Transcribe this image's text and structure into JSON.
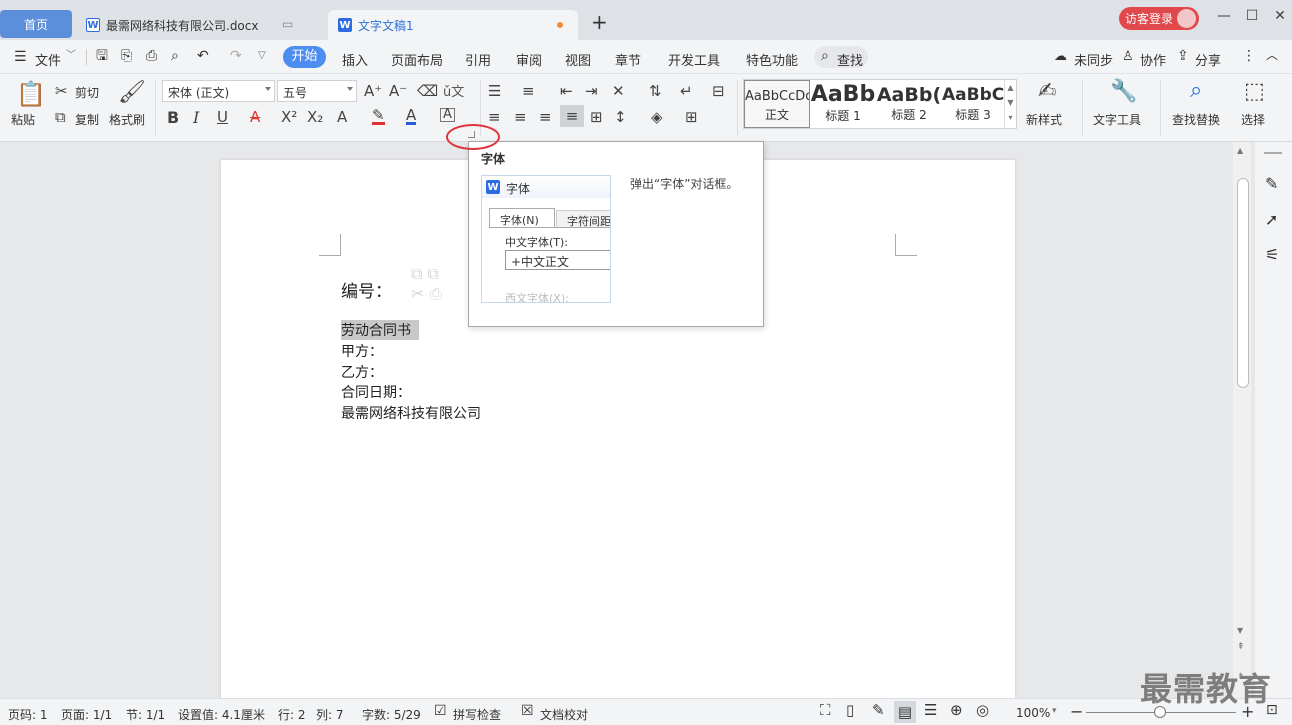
{
  "titlebar": {
    "tabs": [
      {
        "label": "首页"
      },
      {
        "label": "最需网络科技有限公司.docx"
      },
      {
        "label": "文字文稿1"
      }
    ],
    "new_tab": "+",
    "login_label": "访客登录",
    "min": "—",
    "max": "☐",
    "close": "✕"
  },
  "menubar": {
    "file": "文件",
    "items": [
      "开始",
      "插入",
      "页面布局",
      "引用",
      "审阅",
      "视图",
      "章节",
      "开发工具",
      "特色功能"
    ],
    "search": "查找",
    "sync": "未同步",
    "collab": "协作",
    "share": "分享"
  },
  "ribbon": {
    "paste": "粘贴",
    "cut": "剪切",
    "copy": "复制",
    "format_painter": "格式刷",
    "font_name": "宋体 (正文)",
    "font_size": "五号",
    "styles": [
      {
        "preview": "AaBbCcDd",
        "name": "正文"
      },
      {
        "preview": "AaBb",
        "name": "标题 1"
      },
      {
        "preview": "AaBb(",
        "name": "标题 2"
      },
      {
        "preview": "AaBbC",
        "name": "标题 3"
      }
    ],
    "new_style": "新样式",
    "text_tools": "文字工具",
    "find_replace": "查找替换",
    "select": "选择"
  },
  "document": {
    "lines": [
      "编号：",
      "劳动合同书",
      "甲方：",
      "乙方：",
      "合同日期：",
      "最需网络科技有限公司"
    ]
  },
  "popup": {
    "title": "字体",
    "desc": "弹出“字体”对话框。",
    "preview": {
      "dialog_title": "字体",
      "tab1": "字体(N)",
      "tab2": "字符间距",
      "label_cn": "中文字体(T):",
      "value_cn": "+中文正文",
      "label_en": "西文字体(X):"
    }
  },
  "statusbar": {
    "page_num": "页码: 1",
    "pages": "页面: 1/1",
    "section": "节: 1/1",
    "setting": "设置值: 4.1厘米",
    "row": "行: 2",
    "col": "列: 7",
    "words": "字数: 5/29",
    "spell": "拼写检查",
    "proof": "文档校对",
    "zoom": "100%"
  },
  "watermark": "最需教育",
  "colors": {
    "accent": "#4d8df2",
    "login": "#e0484c",
    "highlight": "#c8c8c8",
    "red_circle": "#e0343a"
  }
}
